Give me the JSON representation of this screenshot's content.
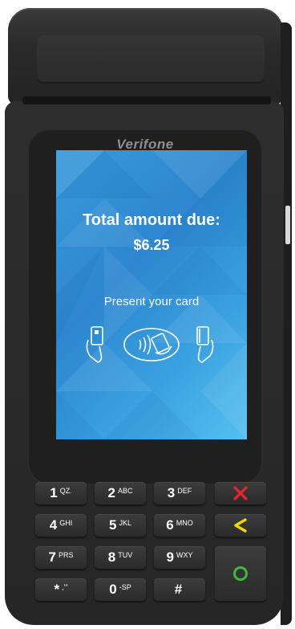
{
  "device": {
    "brand": "Verifone"
  },
  "screen": {
    "title": "Total amount due:",
    "amount": "$6.25",
    "prompt": "Present your card",
    "icons": [
      "card-insert-icon",
      "contactless-tap-icon",
      "card-swipe-icon"
    ]
  },
  "keypad": {
    "keys": [
      {
        "num": "1",
        "sub": "QZ."
      },
      {
        "num": "2",
        "sub": "ABC"
      },
      {
        "num": "3",
        "sub": "DEF"
      },
      {
        "num": "4",
        "sub": "GHI"
      },
      {
        "num": "5",
        "sub": "JKL"
      },
      {
        "num": "6",
        "sub": "MNO"
      },
      {
        "num": "7",
        "sub": "PRS"
      },
      {
        "num": "8",
        "sub": "TUV"
      },
      {
        "num": "9",
        "sub": "WXY"
      },
      {
        "num": "*",
        "sub": ",'\""
      },
      {
        "num": "0",
        "sub": "-SP"
      },
      {
        "num": "#",
        "sub": ""
      }
    ],
    "function_keys": {
      "cancel_icon": "x-icon",
      "clear_icon": "backspace-chevron-icon",
      "enter_icon": "circle-icon"
    }
  },
  "colors": {
    "screen_blue": "#2d86cf",
    "cancel_red": "#e8262a",
    "clear_yellow": "#f2d600",
    "enter_green": "#3fb93f"
  }
}
